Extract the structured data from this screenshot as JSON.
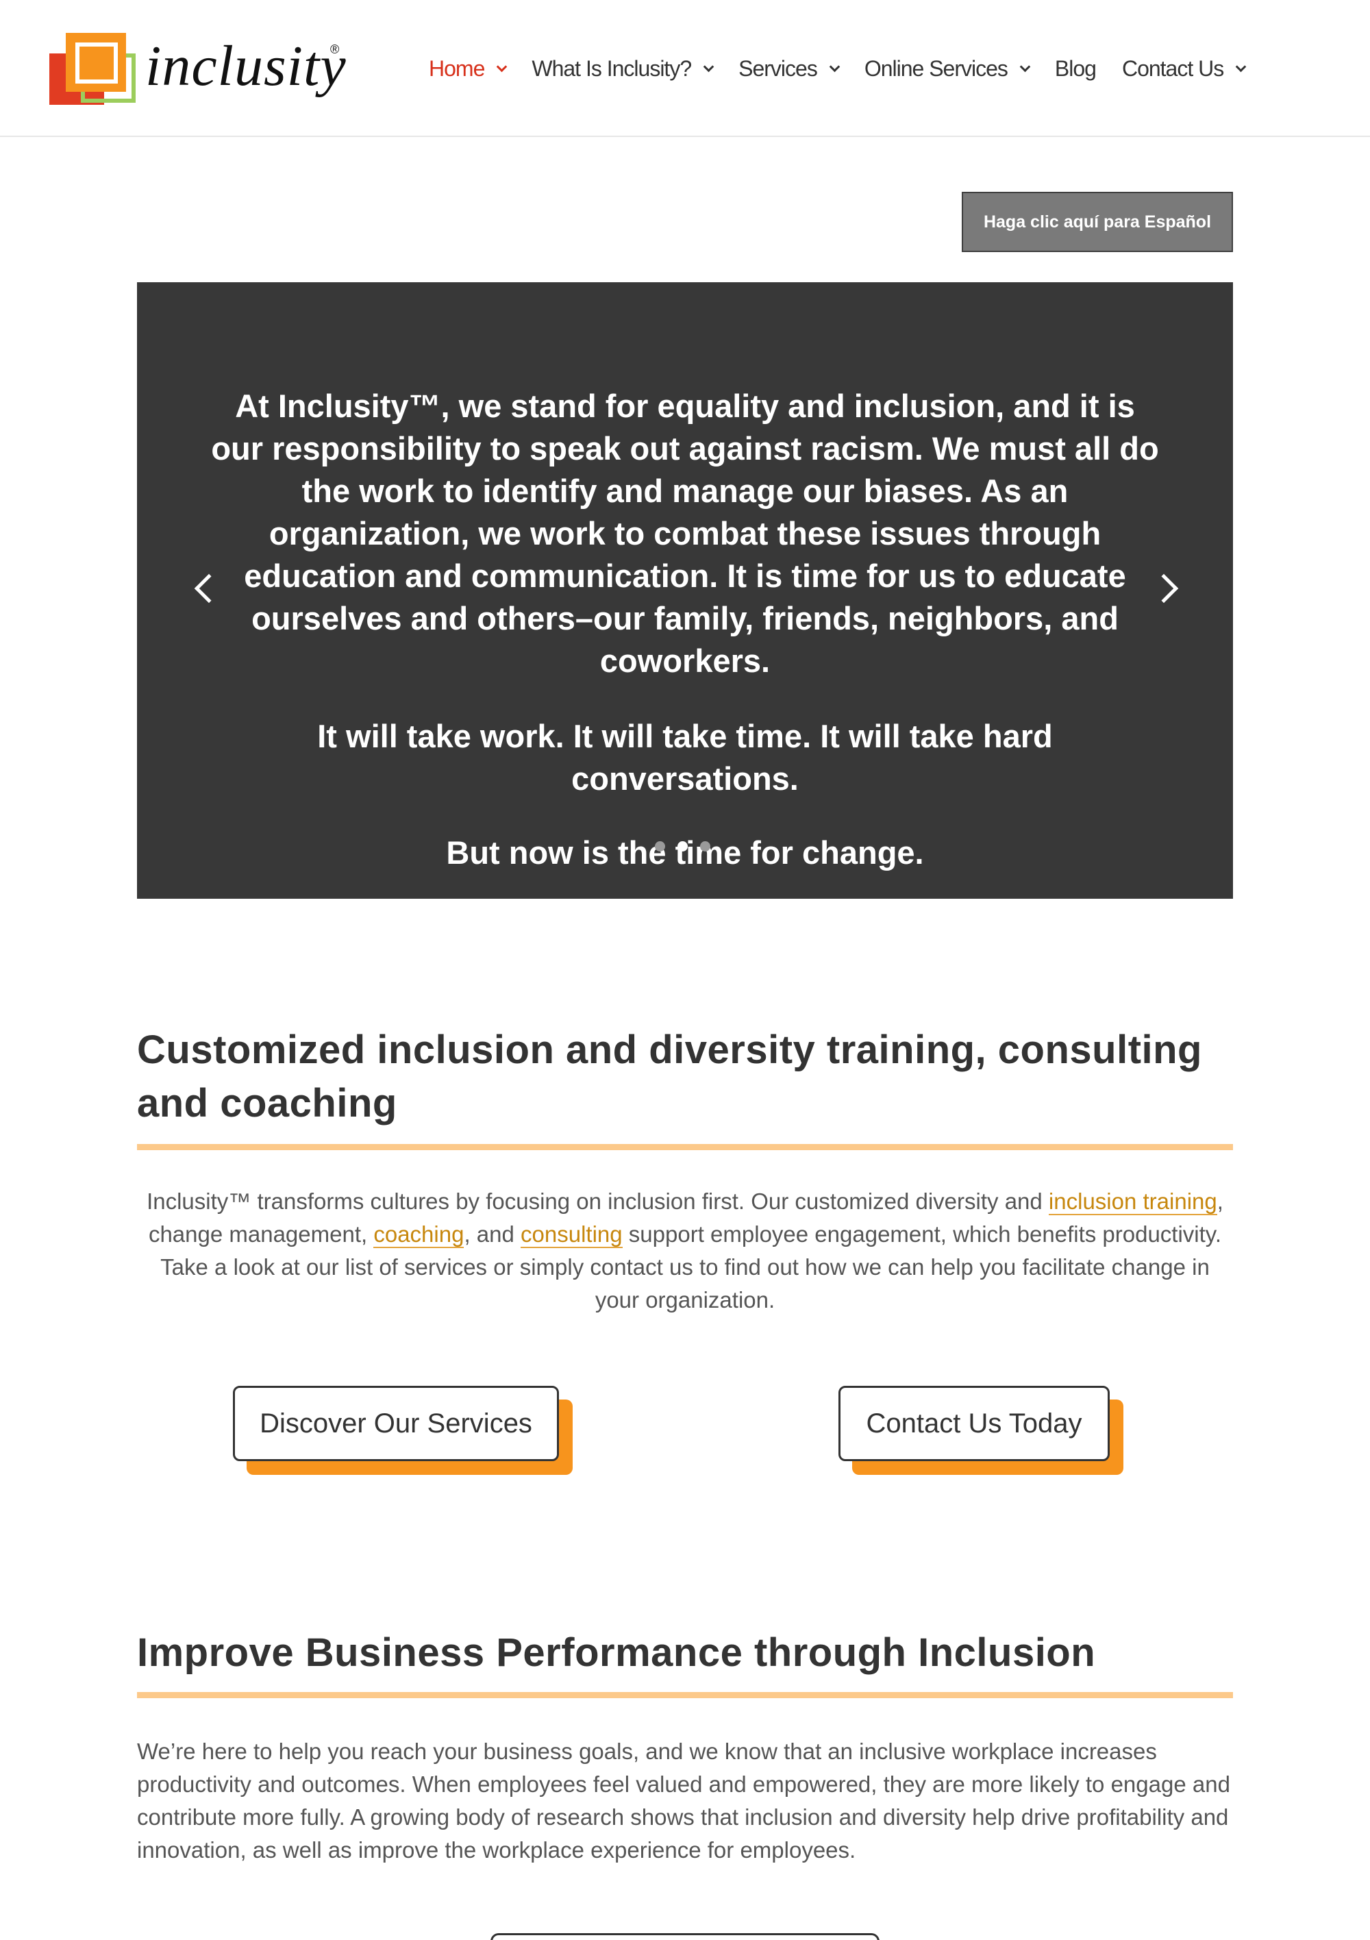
{
  "header": {
    "logo_text": "inclusity",
    "logo_mark": "®",
    "nav": [
      {
        "label": "Home",
        "has_dropdown": true,
        "active": true
      },
      {
        "label": "What Is Inclusity?",
        "has_dropdown": true
      },
      {
        "label": "Services",
        "has_dropdown": true
      },
      {
        "label": "Online Services",
        "has_dropdown": true
      },
      {
        "label": "Blog",
        "has_dropdown": false
      },
      {
        "label": "Contact Us",
        "has_dropdown": true
      }
    ]
  },
  "spanish_button": "Haga clic aquí para Español",
  "slider": {
    "paragraphs": [
      "At Inclusity™, we stand for equality and inclusion, and it is our responsibility to speak out against racism. We must all do the work to identify and manage our biases. As an organization, we work to combat these issues through education and communication. It is time for us to educate ourselves and others–our family, friends, neighbors, and coworkers.",
      "It will take work. It will take time. It will take hard conversations.",
      "But now is the time for change."
    ],
    "active_dot": 2,
    "dot_count": 3
  },
  "section1": {
    "heading": "Customized inclusion and diversity training, consulting and coaching",
    "text_a": "Inclusity™ transforms cultures by focusing on inclusion first. Our customized diversity and ",
    "link_training": "inclusion training",
    "text_b": ", change management, ",
    "link_coaching": "coaching",
    "text_c": ", and ",
    "link_consulting": "consulting",
    "text_d": " support employee engagement, which benefits productivity. Take a look at our list of services or simply contact us to find out how we can help you facilitate change in your organization.",
    "button_services": "Discover Our Services",
    "button_contact": "Contact Us Today"
  },
  "section2": {
    "heading": "Improve Business Performance through Inclusion",
    "text": "We’re here to help you reach your business goals, and we know that an inclusive workplace increases productivity and outcomes. When employees feel valued and empowered, they are more likely to engage and contribute more fully. A growing body of research shows that inclusion and diversity help drive profitability and innovation, as well as improve the workplace experience for employees."
  },
  "colors": {
    "accent_orange": "#f7941d",
    "nav_active": "#d7311b",
    "rule": "#fcc98a",
    "slider_bg": "#383838",
    "link": "#c7870e"
  }
}
